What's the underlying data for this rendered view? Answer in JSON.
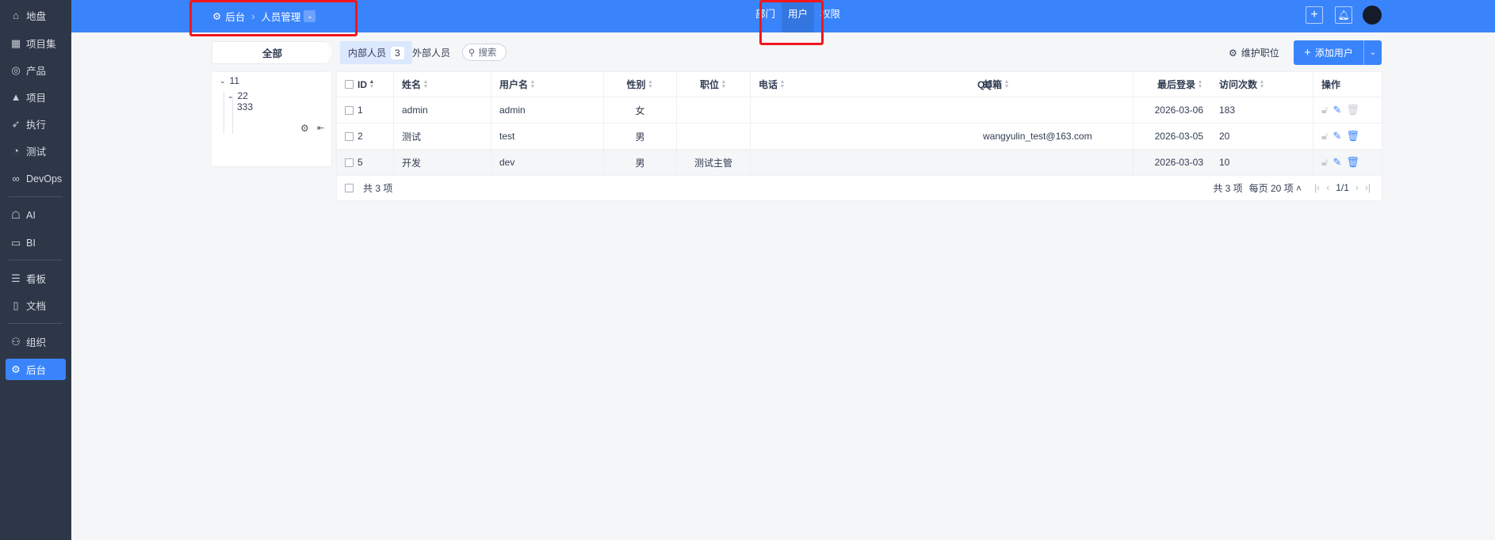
{
  "sidebar": {
    "items": [
      {
        "label": "地盘",
        "icon": "home-icon"
      },
      {
        "label": "项目集",
        "icon": "grid-icon"
      },
      {
        "label": "产品",
        "icon": "bulb-icon"
      },
      {
        "label": "项目",
        "icon": "rocket-icon"
      },
      {
        "label": "执行",
        "icon": "run-icon"
      },
      {
        "label": "测试",
        "icon": "test-icon"
      },
      {
        "label": "DevOps",
        "icon": "infinity-icon"
      },
      {
        "label": "AI",
        "icon": "robot-icon"
      },
      {
        "label": "BI",
        "icon": "chart-board-icon"
      },
      {
        "label": "看板",
        "icon": "kanban-icon"
      },
      {
        "label": "文档",
        "icon": "document-icon"
      },
      {
        "label": "组织",
        "icon": "users-icon"
      },
      {
        "label": "后台",
        "icon": "gear-icon",
        "active": true
      }
    ]
  },
  "header": {
    "breadcrumb": [
      "后台",
      "人员管理"
    ],
    "tabs": [
      {
        "label": "部门"
      },
      {
        "label": "用户",
        "active": true
      },
      {
        "label": "权限"
      }
    ]
  },
  "toolbar": {
    "all": "全部",
    "internal": "内部人员",
    "internal_count": "3",
    "external": "外部人员",
    "search": "搜索",
    "maintain": "维护职位",
    "add": "添加用户"
  },
  "tree": {
    "nodes": [
      "11",
      "22",
      "333"
    ]
  },
  "table": {
    "columns": [
      "ID",
      "姓名",
      "用户名",
      "性别",
      "职位",
      "电话",
      "QQ",
      "邮箱",
      "最后登录",
      "访问次数",
      "操作"
    ],
    "rows": [
      {
        "id": "1",
        "name": "admin",
        "username": "admin",
        "gender": "女",
        "position": "",
        "phone": "",
        "qq": "",
        "email": "",
        "last_login": "2026-03-06",
        "visits": "183"
      },
      {
        "id": "2",
        "name": "测试",
        "username": "test",
        "gender": "男",
        "position": "",
        "phone": "",
        "qq": "",
        "email": "wangyulin_test@163.com",
        "last_login": "2026-03-05",
        "visits": "20"
      },
      {
        "id": "5",
        "name": "开发",
        "username": "dev",
        "gender": "男",
        "position": "测试主管",
        "phone": "",
        "qq": "",
        "email": "",
        "last_login": "2026-03-03",
        "visits": "10"
      }
    ],
    "footer": {
      "summary": "共 3 项",
      "total": "共 3 项",
      "per_page": "每页 20 项",
      "page": "1/1"
    }
  },
  "colors": {
    "primary": "#3a84fb",
    "sidebar": "#2e3748",
    "annotation": "#f2161c"
  }
}
